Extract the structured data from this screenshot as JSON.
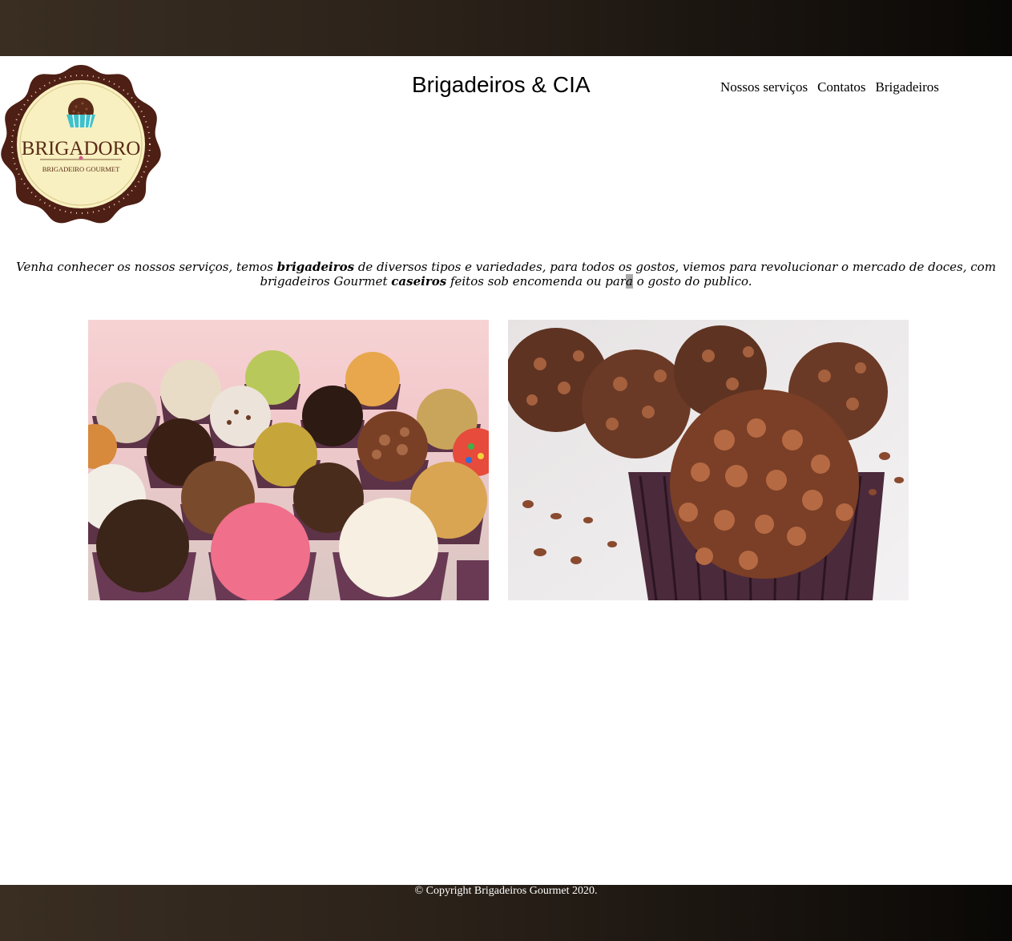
{
  "header": {
    "title": "Brigadeiros & CIA",
    "nav": [
      "Nossos serviços",
      "Contatos",
      "Brigadeiros"
    ]
  },
  "logo": {
    "brand": "BRIGADORO",
    "tagline": "BRIGADEIRO GOURMET",
    "colors": {
      "ring": "#4e1f14",
      "face": "#f8f0c0",
      "text": "#5a2a18",
      "cup": "#3fc1c9"
    }
  },
  "intro": {
    "part1": "Venha conhecer os nossos serviços, temos ",
    "bold1": "brigadeiros",
    "part2": " de diversos tipos e variedades, para todos os gostos, viemos para revolucionar o mercado de doces, com brigadeiros Gourmet ",
    "bold2": "caseiros",
    "part3": " feitos sob encomenda ou par",
    "highlighted": "a",
    "part4": " o gosto do publico."
  },
  "gallery": {
    "images": [
      "assorted-brigadeiros-photo",
      "chocolate-brigadeiro-closeup-photo"
    ]
  },
  "footer": {
    "copyright": "© Copyright Brigadeiros Gourmet 2020."
  }
}
